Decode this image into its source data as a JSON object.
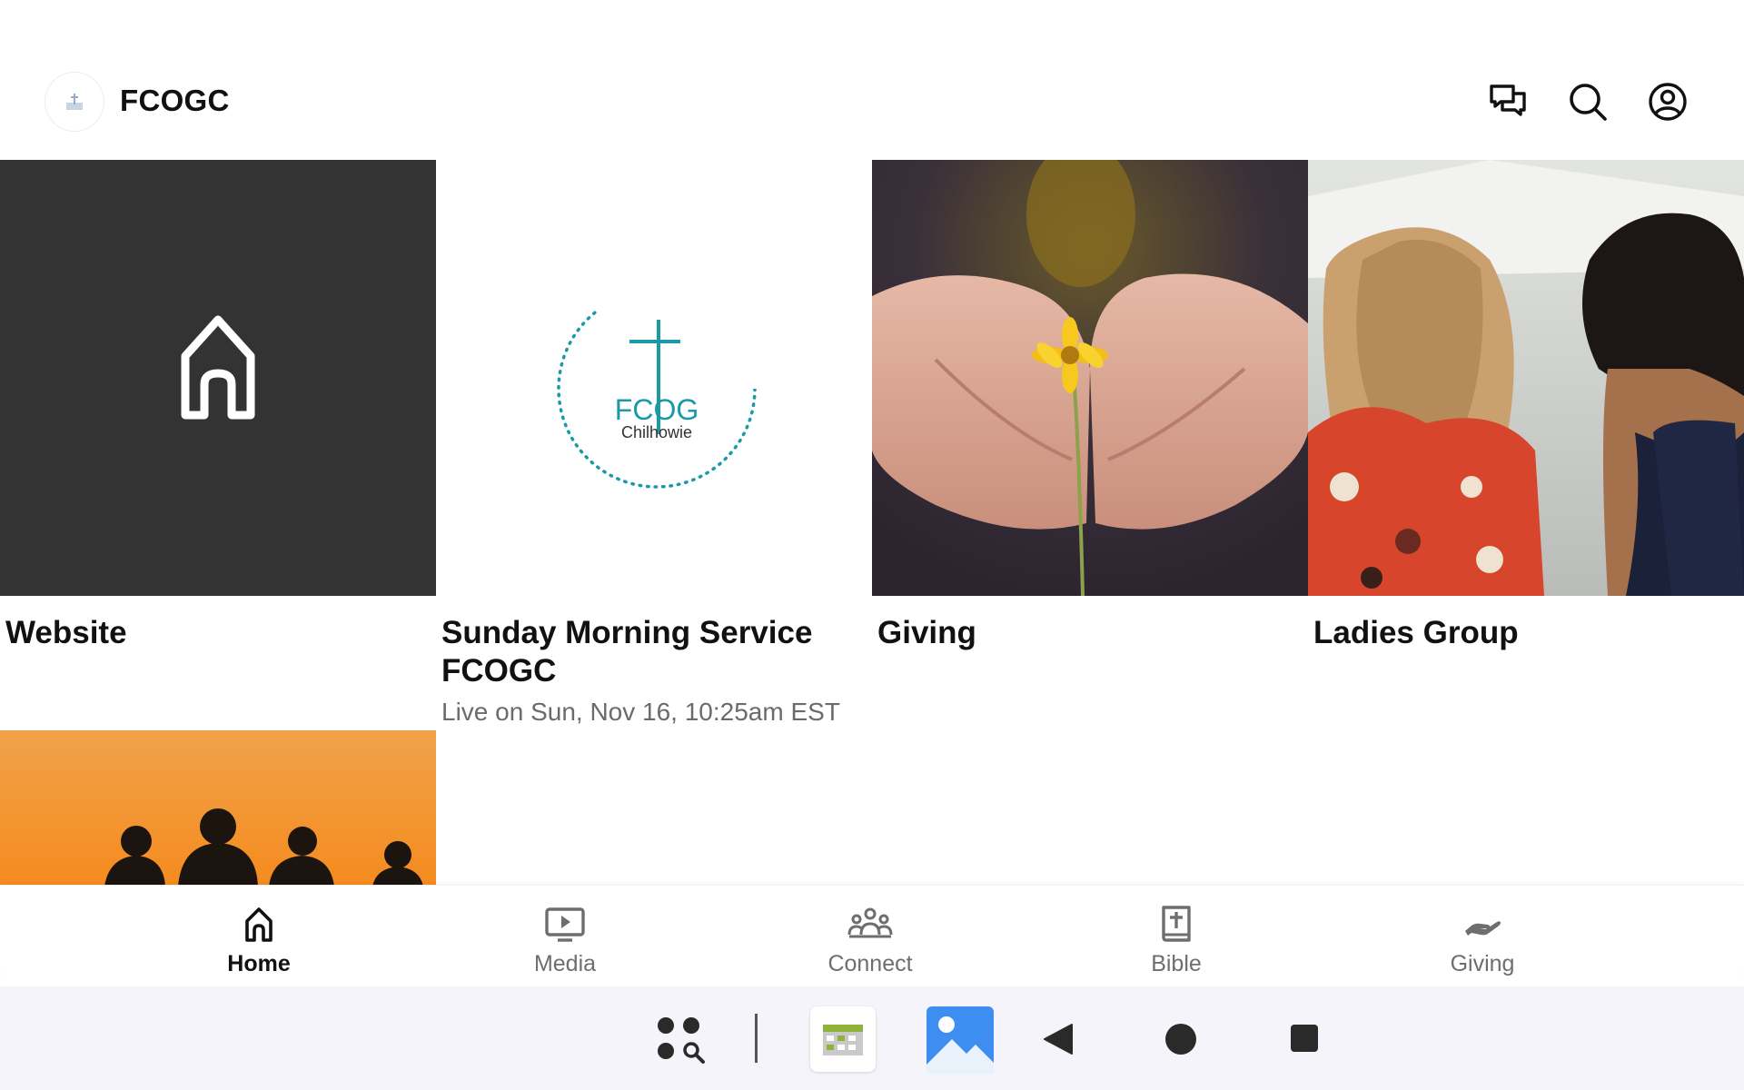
{
  "header": {
    "title": "FCOGC",
    "icons": [
      "chat-icon",
      "search-icon",
      "account-icon"
    ]
  },
  "tiles": [
    {
      "title": "Website",
      "subtitle": "",
      "image": "home-icon"
    },
    {
      "title": "Sunday Morning Service FCOGC",
      "subtitle": "Live on Sun, Nov 16, 10:25am EST",
      "image": "fcog-chilhowie-logo",
      "logo_text_1": "FCOG",
      "logo_text_2": "Chilhowie"
    },
    {
      "title": "Giving",
      "subtitle": "",
      "image": "hands-flower-photo"
    },
    {
      "title": "Ladies Group",
      "subtitle": "",
      "image": "two-women-photo"
    }
  ],
  "bottom_nav": {
    "items": [
      {
        "label": "Home",
        "icon": "home-icon",
        "active": true
      },
      {
        "label": "Media",
        "icon": "media-icon",
        "active": false
      },
      {
        "label": "Connect",
        "icon": "people-icon",
        "active": false
      },
      {
        "label": "Bible",
        "icon": "bible-icon",
        "active": false
      },
      {
        "label": "Giving",
        "icon": "giving-hand-icon",
        "active": false
      }
    ]
  },
  "system_bar": {
    "icons": [
      "app-drawer-icon",
      "calendar-app-icon",
      "gallery-app-icon",
      "back-icon",
      "home-circle-icon",
      "recents-icon"
    ]
  },
  "colors": {
    "website_tile_bg": "#333333",
    "logo_teal": "#1a9aa6",
    "sunset_orange": "#f2a03c"
  }
}
